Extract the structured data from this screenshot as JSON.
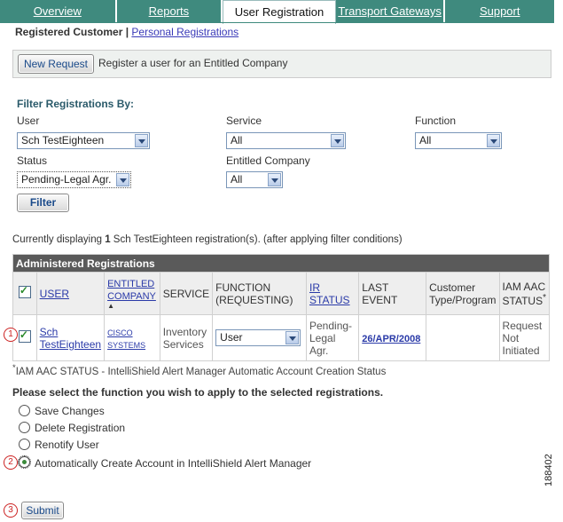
{
  "tabs": [
    "Overview",
    "Reports",
    "User Registration",
    "Transport Gateways",
    "Support"
  ],
  "subnav": {
    "current": "Registered Customer",
    "separator": " | ",
    "link": "Personal Registrations"
  },
  "request": {
    "button": "New Request",
    "text": "Register a user for an Entitled Company"
  },
  "filter": {
    "title": "Filter Registrations By:",
    "user_label": "User",
    "user_value": "Sch TestEighteen",
    "service_label": "Service",
    "service_value": "All",
    "function_label": "Function",
    "function_value": "All",
    "status_label": "Status",
    "status_value": "Pending-Legal Agr.",
    "company_label": "Entitled Company",
    "company_value": "All",
    "button": "Filter"
  },
  "info": {
    "prefix": "Currently displaying ",
    "count": "1",
    "suffix": " Sch TestEighteen registration(s). (after applying filter conditions)"
  },
  "table": {
    "title": "Administered Registrations",
    "headers": {
      "user": "USER",
      "company": "ENTITLED COMPANY",
      "service": "SERVICE",
      "function": "FUNCTION (REQUESTING)",
      "ir_status": "IR STATUS",
      "last_event": "LAST EVENT",
      "customer_type": "Customer Type/Program",
      "iam": "IAM AAC STATUS",
      "iam_mark": "*"
    },
    "row": {
      "user": "Sch TestEighteen",
      "company": "CISCO SYSTEMS",
      "service": "Inventory Services",
      "function": "User",
      "ir_status": "Pending-Legal Agr.",
      "last_event": "26/APR/2008",
      "customer_type": "",
      "iam": "Request Not Initiated"
    }
  },
  "footnote": "IAM AAC STATUS - IntelliShield Alert Manager Automatic Account Creation Status",
  "footnote_mark": "*",
  "question": "Please select the function you wish to apply to the selected registrations.",
  "options": [
    "Save Changes",
    "Delete Registration",
    "Renotify User",
    "Automatically Create Account in IntelliShield Alert Manager"
  ],
  "submit": "Submit",
  "callouts": [
    "1",
    "2",
    "3"
  ],
  "figure_id": "188402"
}
